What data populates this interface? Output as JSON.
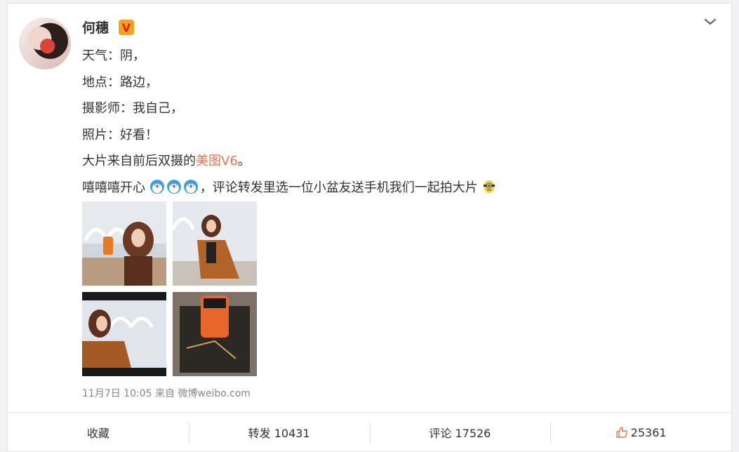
{
  "post": {
    "author": "何穗",
    "verified_icon": "verified-v-badge",
    "verified_mark": "V",
    "lines": [
      "天气：阴，",
      "地点：路边，",
      "摄影师：我自己，",
      "照片：好看！"
    ],
    "line5_pre": "大片来自前后双摄的",
    "line5_link": "美图V6",
    "line5_post": "。",
    "line6_pre": "嘻嘻嘻开心",
    "line6_post": "，评论转发里选一位小盆友送手机我们一起拍大片",
    "timestamp": "11月7日 10:05",
    "source_prefix": "来自",
    "source": "微博weibo.com"
  },
  "actions": {
    "favorite": "收藏",
    "repost": "转发 10431",
    "comment": "评论 17526",
    "like": "25361"
  },
  "colors": {
    "accent_link": "#eb7350",
    "like_icon": "#eb7350",
    "badge_bg": "#f7a21d",
    "badge_text": "#e02020"
  }
}
